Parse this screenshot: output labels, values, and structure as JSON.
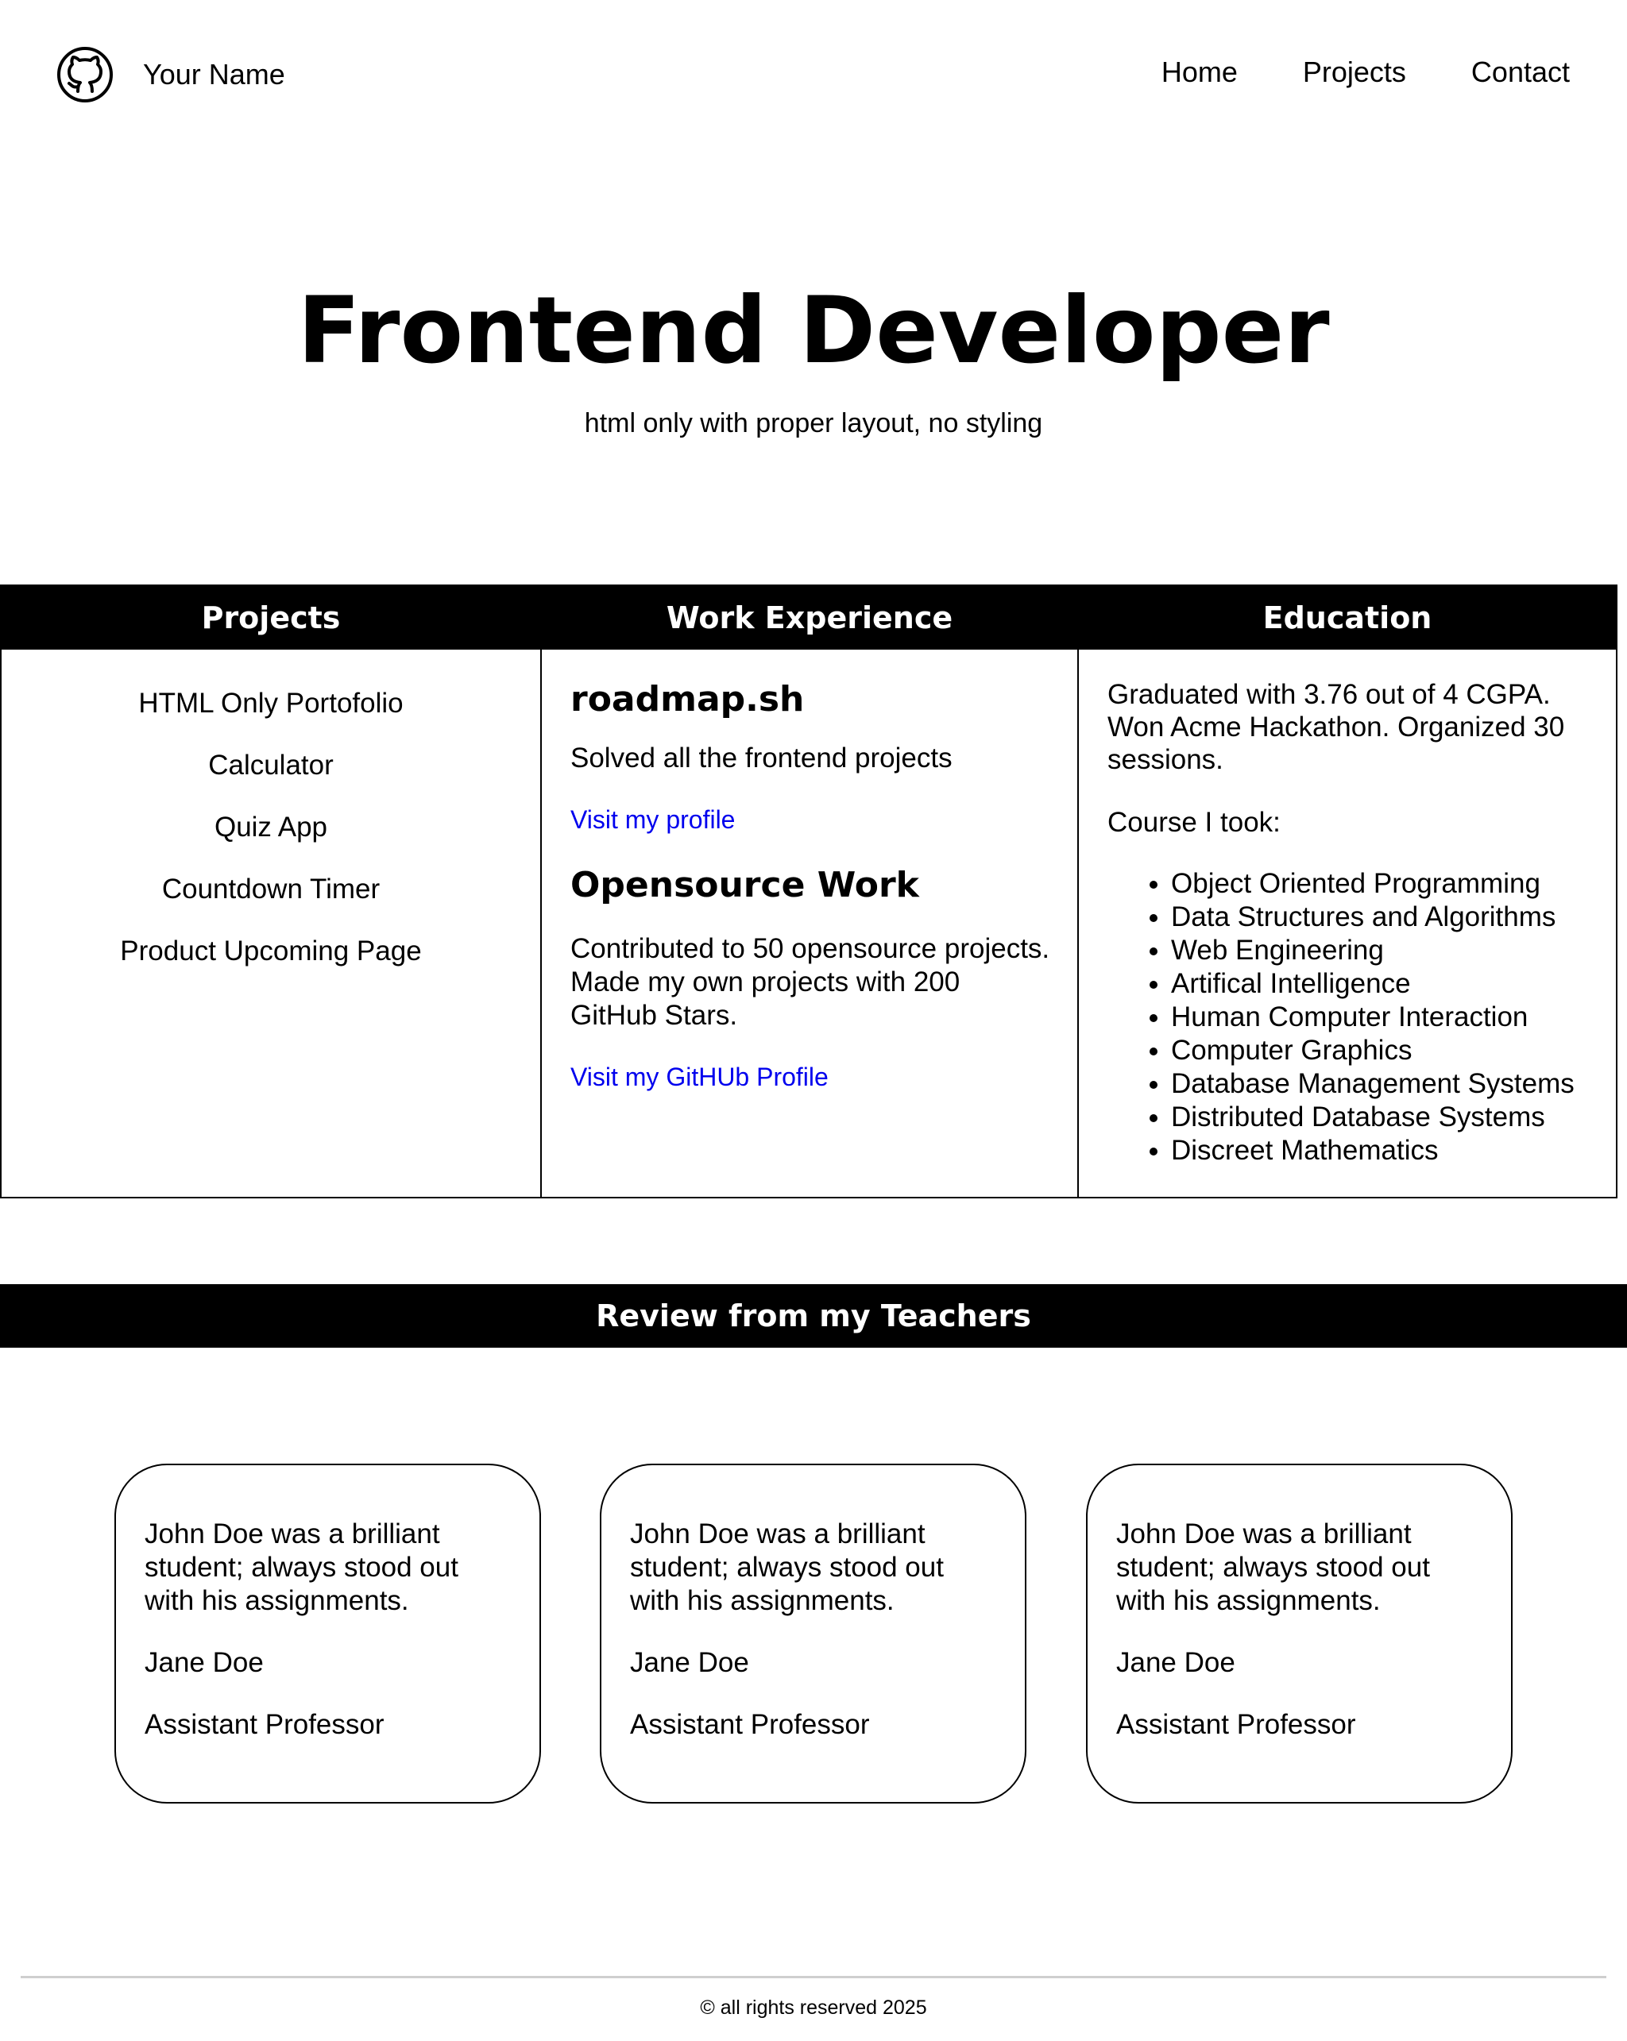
{
  "header": {
    "brand_name": "Your Name",
    "nav": [
      "Home",
      "Projects",
      "Contact"
    ]
  },
  "hero": {
    "title": "Frontend Developer",
    "subtitle": "html only with proper layout, no styling"
  },
  "sections": {
    "projects": {
      "heading": "Projects",
      "items": [
        "HTML Only Portofolio",
        "Calculator",
        "Quiz App",
        "Countdown Timer",
        "Product Upcoming Page"
      ]
    },
    "work": {
      "heading": "Work Experience",
      "entries": [
        {
          "title": "roadmap.sh",
          "description": "Solved all the frontend projects",
          "link": "Visit my profile"
        },
        {
          "title": "Opensource Work",
          "description": "Contributed to 50 opensource projects. Made my own projects with 200 GitHub Stars.",
          "link": "Visit my GitHUb Profile"
        }
      ]
    },
    "education": {
      "heading": "Education",
      "summary": "Graduated with 3.76 out of 4 CGPA. Won Acme Hackathon. Organized 30 sessions.",
      "courses_label": "Course I took:",
      "courses": [
        "Object Oriented Programming",
        "Data Structures and Algorithms",
        "Web Engineering",
        "Artifical Intelligence",
        "Human Computer Interaction",
        "Computer Graphics",
        "Database Management Systems",
        "Distributed Database Systems",
        "Discreet Mathematics"
      ]
    }
  },
  "reviews": {
    "heading": "Review from my Teachers",
    "cards": [
      {
        "quote": "John Doe was a brilliant student; always stood out with his assignments.",
        "name": "Jane Doe",
        "title": "Assistant Professor"
      },
      {
        "quote": "John Doe was a brilliant student; always stood out with his assignments.",
        "name": "Jane Doe",
        "title": "Assistant Professor"
      },
      {
        "quote": "John Doe was a brilliant student; always stood out with his assignments.",
        "name": "Jane Doe",
        "title": "Assistant Professor"
      }
    ]
  },
  "footer": {
    "text": "© all rights reserved 2025"
  },
  "colors": {
    "text": "#000000",
    "background": "#ffffff",
    "link": "#0000ee",
    "footer_rule": "#cfcfcf"
  },
  "icons": {
    "brand": "github-icon"
  }
}
